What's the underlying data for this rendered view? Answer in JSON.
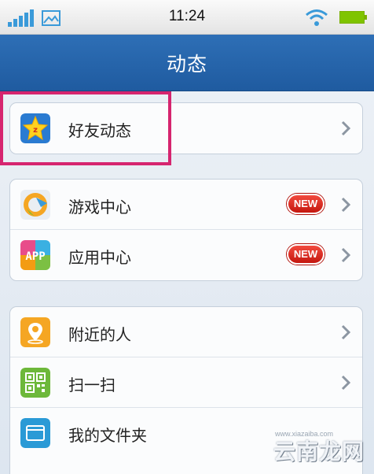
{
  "status_bar": {
    "time": "11:24",
    "icons": [
      "signal-icon",
      "gallery-icon",
      "wifi-icon",
      "battery-icon"
    ]
  },
  "header": {
    "title": "动态"
  },
  "groups": [
    {
      "items": [
        {
          "label": "好友动态",
          "icon": "qzone-star-icon"
        }
      ]
    },
    {
      "items": [
        {
          "label": "游戏中心",
          "icon": "game-center-icon",
          "badge": "NEW"
        },
        {
          "label": "应用中心",
          "icon": "app-center-icon",
          "badge": "NEW"
        }
      ]
    },
    {
      "items": [
        {
          "label": "附近的人",
          "icon": "location-pin-icon"
        },
        {
          "label": "扫一扫",
          "icon": "qr-code-icon"
        },
        {
          "label": "我的文件夹",
          "icon": "folder-icon"
        }
      ]
    }
  ],
  "app_icon_text": "APP",
  "watermark": {
    "text": "云南龙网",
    "url": "www.xiazaiba.com"
  },
  "colors": {
    "title_bar": "#2e6fb6",
    "badge": "#e0261c",
    "highlight": "#d6256f",
    "signal": "#3a9ad9",
    "battery": "#7fc400"
  }
}
